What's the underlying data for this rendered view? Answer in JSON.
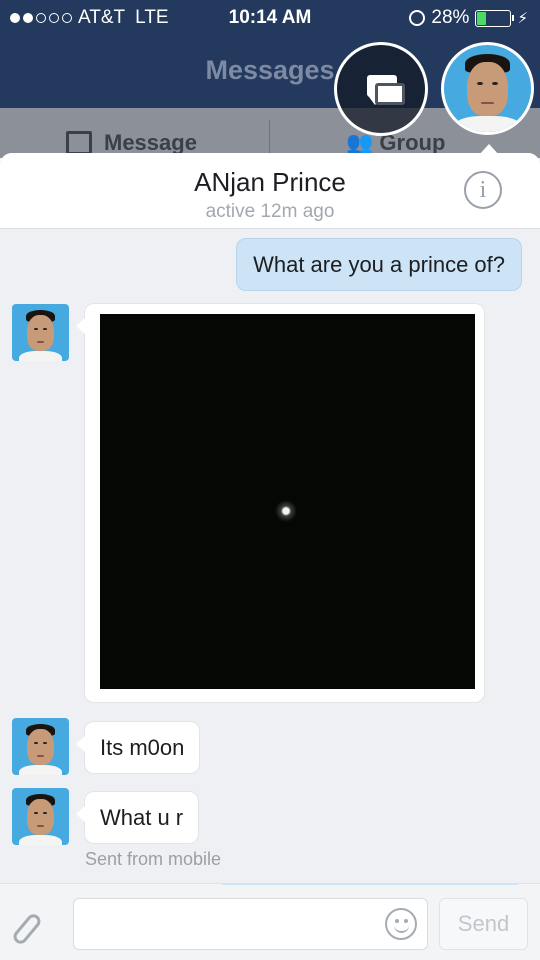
{
  "status_bar": {
    "carrier": "AT&T",
    "network": "LTE",
    "time": "10:14 AM",
    "battery_percent": "28%",
    "battery_level": 0.28,
    "signal_bars_filled": 2,
    "signal_bars_total": 5
  },
  "header": {
    "title": "Messages",
    "chat_heads_icon": "chat-bubbles-icon",
    "profile_avatar": "user-avatar"
  },
  "action_bar": {
    "message_label": "Message",
    "group_label": "Group"
  },
  "conversation": {
    "name": "ANjan Prince",
    "status": "active 12m ago",
    "info_icon": "info-icon",
    "info_glyph": "i"
  },
  "messages": [
    {
      "direction": "outgoing",
      "type": "text",
      "text": "What are you a prince of?"
    },
    {
      "direction": "incoming",
      "type": "image",
      "description_icon": "photo"
    },
    {
      "direction": "incoming",
      "type": "text",
      "text": "Its m0on"
    },
    {
      "direction": "incoming",
      "type": "text",
      "text": "What u r"
    }
  ],
  "sent_note": "Sent from mobile",
  "composer": {
    "attach_icon": "paperclip-icon",
    "emoji_icon": "smiley-icon",
    "placeholder": "",
    "send_label": "Send"
  },
  "colors": {
    "header_bg": "#23395d",
    "outgoing_bubble": "#cde4f7",
    "battery_fill": "#4cd964"
  }
}
